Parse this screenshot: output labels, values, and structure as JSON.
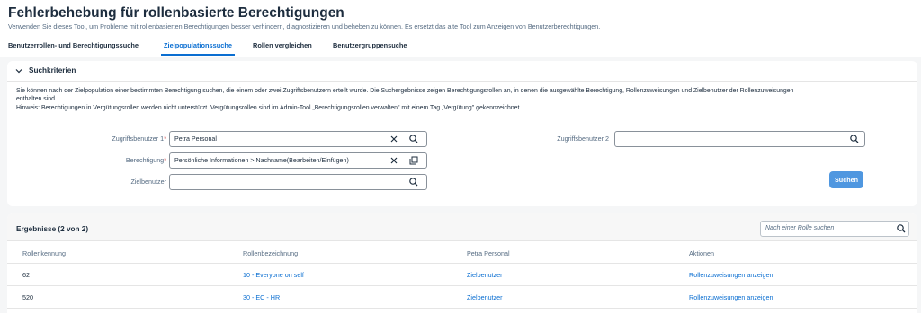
{
  "header": {
    "title": "Fehlerbehebung für rollenbasierte Berechtigungen",
    "subtitle": "Verwenden Sie dieses Tool, um Probleme mit rollenbasierten Berechtigungen besser verhindern, diagnostizieren und beheben zu können. Es ersetzt das alte Tool zum Anzeigen von Benutzerberechtigungen."
  },
  "tabs": [
    {
      "label": "Benutzerrollen- und Berechtigungssuche"
    },
    {
      "label": "Zielpopulationssuche",
      "active": true
    },
    {
      "label": "Rollen vergleichen"
    },
    {
      "label": "Benutzergruppensuche"
    }
  ],
  "criteria": {
    "title": "Suchkriterien",
    "desc_line1": "Sie können nach der Zielpopulation einer bestimmten Berechtigung suchen, die einem oder zwei Zugriffsbenutzern erteilt wurde. Die Suchergebnisse zeigen Berechtigungsrollen an, in denen die ausgewählte Berechtigung, Rollenzuweisungen und Zielbenutzer der Rollenzuweisungen",
    "desc_line2": "enthalten sind.",
    "desc_line3": "Hinweis: Berechtigungen in Vergütungsrollen werden nicht unterstützt. Vergütungsrollen sind im Admin-Tool „Berechtigungsrollen verwalten\" mit einem Tag „Vergütung\" gekennzeichnet.",
    "field1_label": "Zugriffsbenutzer 1",
    "field1_value": "Petra Personal",
    "field2_label": "Berechtigung",
    "field2_value": "Persönliche Informationen > Nachname(Bearbeiten/Einfügen)",
    "field3_label": "Zielbenutzer",
    "field3_value": "",
    "field4_label": "Zugriffsbenutzer 2",
    "field4_value": "",
    "required_mark": "*",
    "search_button": "Suchen"
  },
  "results": {
    "title": "Ergebnisse (2 von 2)",
    "search_placeholder": "Nach einer Rolle suchen",
    "columns": [
      "Rollenkennung",
      "Rollenbezeichnung",
      "Petra Personal",
      "Aktionen"
    ],
    "rows": [
      {
        "id": "62",
        "name": "10 - Everyone on self",
        "user": "Zielbenutzer",
        "action": "Rollenzuweisungen anzeigen"
      },
      {
        "id": "520",
        "name": "30 - EC - HR",
        "user": "Zielbenutzer",
        "action": "Rollenzuweisungen anzeigen"
      }
    ]
  },
  "colors": {
    "accent": "#0a6ed1",
    "button": "#4f97e0",
    "required": "#bb0000"
  },
  "icons": [
    "chevron-down-icon",
    "clear-icon",
    "search-icon",
    "value-help-icon"
  ]
}
